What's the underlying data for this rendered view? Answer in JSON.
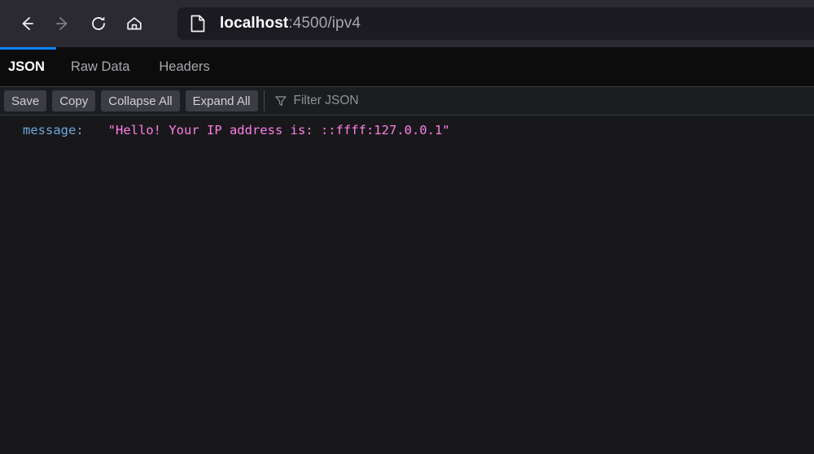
{
  "browser": {
    "nav": {
      "back_label": "Back",
      "forward_label": "Forward",
      "reload_label": "Reload",
      "home_label": "Home"
    },
    "urlbar": {
      "page_icon": "document-icon",
      "host": "localhost",
      "rest": ":4500/ipv4",
      "full_url": "localhost:4500/ipv4"
    },
    "colors": {
      "chrome_bg": "#2b2a33",
      "urlbar_bg": "#1c1b22",
      "accent": "#0a84ff"
    }
  },
  "viewer": {
    "tabs": [
      {
        "label": "JSON",
        "active": true
      },
      {
        "label": "Raw Data",
        "active": false
      },
      {
        "label": "Headers",
        "active": false
      }
    ],
    "toolbar": {
      "save_label": "Save",
      "copy_label": "Copy",
      "collapse_all_label": "Collapse All",
      "expand_all_label": "Expand All",
      "filter_icon": "filter-funnel-icon",
      "filter_placeholder": "Filter JSON"
    },
    "json": {
      "rows": [
        {
          "key": "message",
          "colon": ":",
          "value": "\"Hello! Your IP address is: ::ffff:127.0.0.1\""
        }
      ],
      "colors": {
        "key": "#6fa8dc",
        "string": "#ff7de9",
        "bg": "#18181a"
      }
    }
  }
}
